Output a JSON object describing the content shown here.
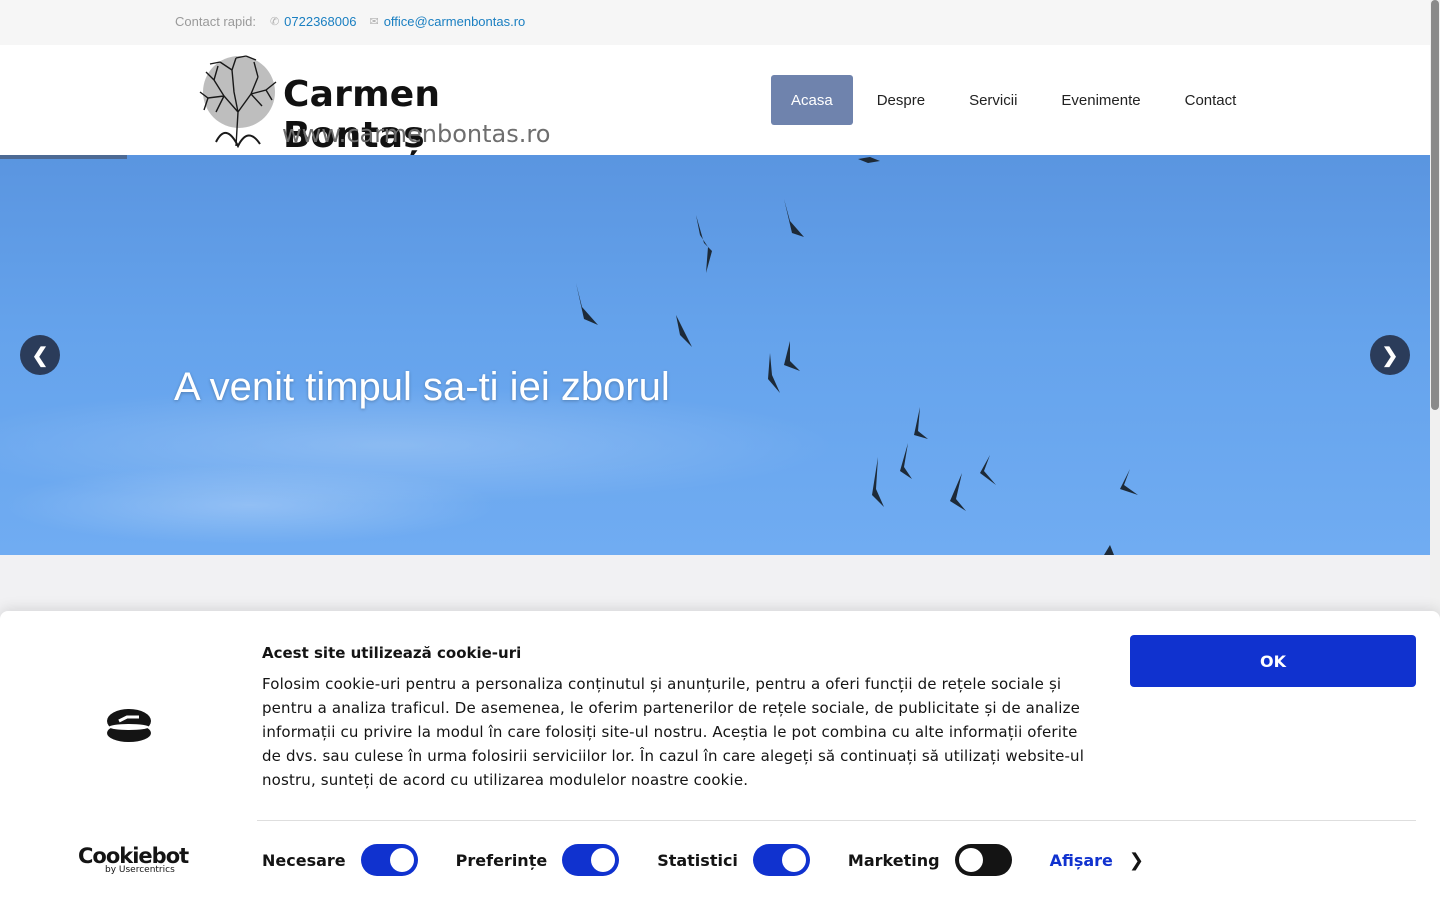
{
  "topbar": {
    "label": "Contact rapid:",
    "phone_icon": "phone-icon",
    "phone": "0722368006",
    "email_icon": "mail-icon",
    "email": "office@carmenbontas.ro"
  },
  "header": {
    "logo": {
      "brand": "Carmen Bontaș",
      "url": "www.carmenbontas.ro",
      "icon": "tree-head-icon"
    },
    "nav": [
      {
        "label": "Acasa",
        "active": true
      },
      {
        "label": "Despre",
        "active": false
      },
      {
        "label": "Servicii",
        "active": false
      },
      {
        "label": "Evenimente",
        "active": false
      },
      {
        "label": "Contact",
        "active": false
      }
    ]
  },
  "hero": {
    "caption": "A venit timpul sa-ti iei zborul",
    "prev_icon": "chevron-left-icon",
    "next_icon": "chevron-right-icon",
    "colors": {
      "sky_top": "#5a95e0",
      "sky_bottom": "#70acf2",
      "arrow_bg": "#2b3c5a"
    }
  },
  "cookie_banner": {
    "provider_brand": "Cookiebot",
    "provider_by": "by Usercentrics",
    "title": "Acest site utilizează cookie-uri",
    "body": "Folosim cookie-uri pentru a personaliza conținutul și anunțurile, pentru a oferi funcții de rețele sociale și pentru a analiza traficul. De asemenea, le oferim partenerilor de rețele sociale, de publicitate și de analize informații cu privire la modul în care folosiți site-ul nostru. Aceștia le pot combina cu alte informații oferite de dvs. sau culese în urma folosirii serviciilor lor. În cazul în care alegeți să continuați să utilizați website-ul nostru, sunteți de acord cu utilizarea modulelor noastre cookie.",
    "ok_label": "OK",
    "toggles": [
      {
        "label": "Necesare",
        "on": true
      },
      {
        "label": "Preferințe",
        "on": true
      },
      {
        "label": "Statistici",
        "on": true
      },
      {
        "label": "Marketing",
        "on": false
      }
    ],
    "details_label": "Afișare",
    "colors": {
      "primary": "#1032cf",
      "text": "#141414"
    }
  }
}
